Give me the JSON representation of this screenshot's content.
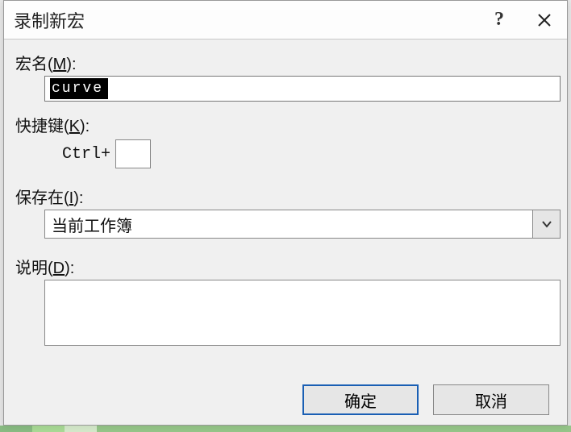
{
  "titlebar": {
    "title": "录制新宏",
    "help": "?",
    "close_aria": "Close"
  },
  "macroName": {
    "label_pre": "宏名(",
    "label_mn": "M",
    "label_post": "):",
    "value": "curve"
  },
  "shortcut": {
    "label_pre": "快捷键(",
    "label_mn": "K",
    "label_post": "):",
    "ctrl": "Ctrl+",
    "value": ""
  },
  "store": {
    "label_pre": "保存在(",
    "label_mn": "I",
    "label_post": "):",
    "value": "当前工作簿"
  },
  "desc": {
    "label_pre": "说明(",
    "label_mn": "D",
    "label_post": "):",
    "value": ""
  },
  "footer": {
    "ok": "确定",
    "cancel": "取消"
  }
}
